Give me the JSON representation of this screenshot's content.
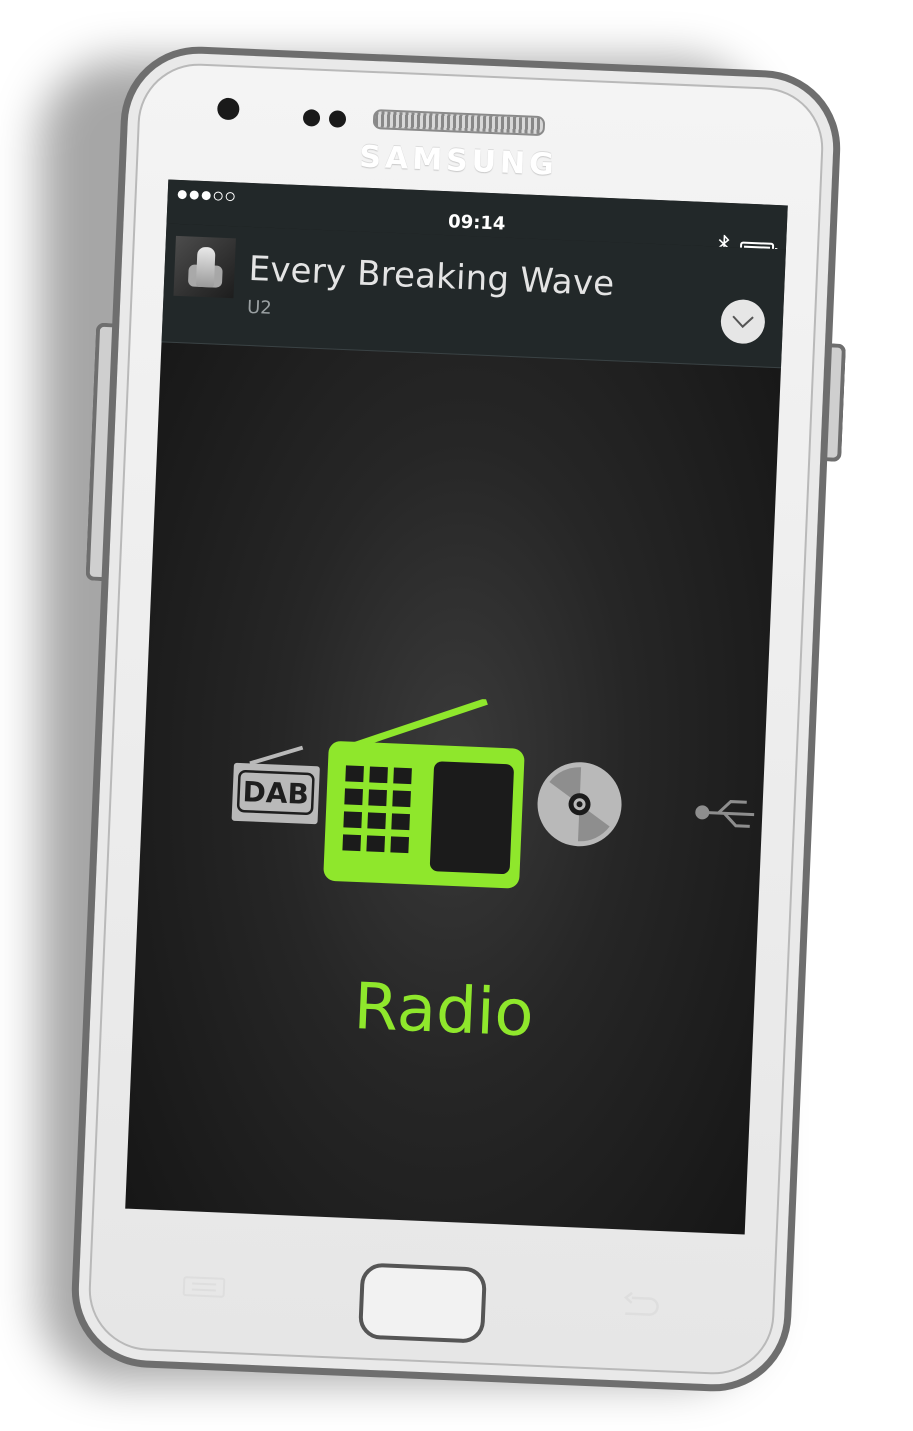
{
  "device": {
    "brand": "SAMSUNG"
  },
  "status_bar": {
    "signal_dots_filled": 3,
    "signal_dots_total": 5,
    "time": "09:14",
    "bluetooth_icon": "bluetooth-icon",
    "battery_icon": "battery-icon"
  },
  "now_playing": {
    "title": "Every Breaking Wave",
    "artist": "U2",
    "collapse_icon": "chevron-down-icon"
  },
  "sources": {
    "items": [
      {
        "name": "DAB",
        "icon": "dab-icon",
        "selected": false
      },
      {
        "name": "Radio",
        "icon": "radio-icon",
        "selected": true
      },
      {
        "name": "CD",
        "icon": "cd-icon",
        "selected": false
      },
      {
        "name": "USB",
        "icon": "usb-icon",
        "selected": false
      }
    ],
    "selected_label": "Radio",
    "dab_text": "DAB"
  },
  "colors": {
    "accent": "#8fe72c",
    "inactive_icon": "#b9b9b9",
    "header_bg": "#222829"
  }
}
